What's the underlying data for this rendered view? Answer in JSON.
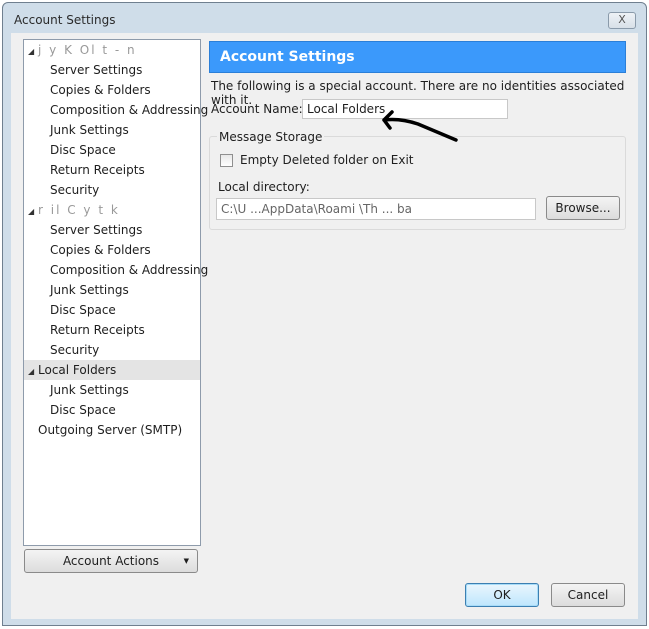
{
  "window": {
    "title": "Account Settings",
    "close_label": "X"
  },
  "tree": [
    {
      "label": "j  y  K  Ol  t   -   n",
      "level": 0,
      "expanded": true,
      "obscured": true
    },
    {
      "label": "Server Settings",
      "level": 1
    },
    {
      "label": "Copies & Folders",
      "level": 1
    },
    {
      "label": "Composition & Addressing",
      "level": 1
    },
    {
      "label": "Junk Settings",
      "level": 1
    },
    {
      "label": "Disc Space",
      "level": 1
    },
    {
      "label": "Return Receipts",
      "level": 1
    },
    {
      "label": "Security",
      "level": 1
    },
    {
      "label": "r  il  C  y   t  k",
      "level": 0,
      "expanded": true,
      "obscured": true
    },
    {
      "label": "Server Settings",
      "level": 1
    },
    {
      "label": "Copies & Folders",
      "level": 1
    },
    {
      "label": "Composition & Addressing",
      "level": 1
    },
    {
      "label": "Junk Settings",
      "level": 1
    },
    {
      "label": "Disc Space",
      "level": 1
    },
    {
      "label": "Return Receipts",
      "level": 1
    },
    {
      "label": "Security",
      "level": 1
    },
    {
      "label": "Local Folders",
      "level": 0,
      "expanded": true,
      "selected": true
    },
    {
      "label": "Junk Settings",
      "level": 1
    },
    {
      "label": "Disc Space",
      "level": 1
    },
    {
      "label": "Outgoing Server (SMTP)",
      "level": 0
    }
  ],
  "account_actions": "Account Actions",
  "main": {
    "banner": "Account Settings",
    "info": "The following is a special account. There are no identities associated with it.",
    "account_name_label": "Account Name:",
    "account_name_value": "Local Folders",
    "storage_group": "Message Storage",
    "empty_deleted_label": "Empty Deleted folder on Exit",
    "empty_deleted_checked": false,
    "local_dir_label": "Local directory:",
    "local_dir_value": "C:\\U    ...AppData\\Roami  \\Th ...  ba",
    "browse": "Browse..."
  },
  "buttons": {
    "ok": "OK",
    "cancel": "Cancel"
  }
}
